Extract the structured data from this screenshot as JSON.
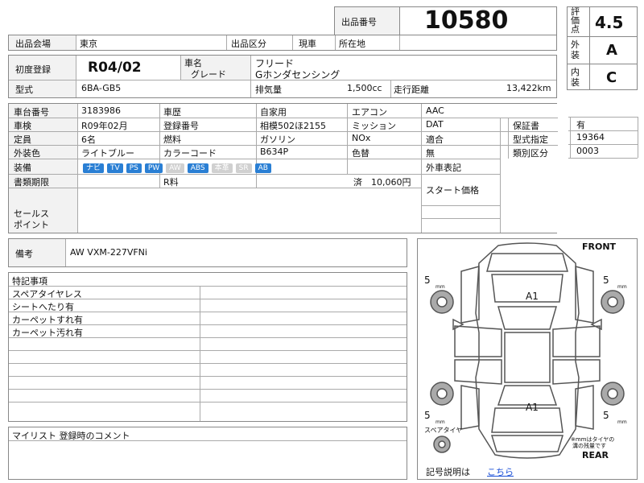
{
  "header": {
    "lot_number_label": "出品番号",
    "lot_number": "10580",
    "venue_label": "出品会場",
    "venue": "東京",
    "category_label": "出品区分",
    "category": "現車",
    "location_label": "所在地",
    "location": ""
  },
  "grades": {
    "overall_label": "評価点",
    "overall": "4.5",
    "exterior_label": "外装",
    "exterior": "A",
    "interior_label": "内装",
    "interior": "C"
  },
  "vehicle": {
    "first_reg_label": "初度登録",
    "first_reg": "R04/02",
    "name_label": "車名",
    "grade_label": "グレード",
    "name": "フリード",
    "grade": "Gホンダセンシング",
    "model_label": "型式",
    "model": "6BA-GB5",
    "displacement_label": "排気量",
    "displacement": "1,500cc",
    "mileage_label": "走行距離",
    "mileage": "13,422km"
  },
  "specs": {
    "chassis_label": "車台番号",
    "chassis": "3183986",
    "history_label": "車歴",
    "history": "自家用",
    "ac_label": "エアコン",
    "ac": "AAC",
    "inspection_label": "車検",
    "inspection": "R09年02月",
    "plate_label": "登録番号",
    "plate": "相模502ほ2155",
    "transmission_label": "ミッション",
    "transmission": "DAT",
    "warranty_label": "保証書",
    "warranty": "有",
    "capacity_label": "定員",
    "capacity": "6名",
    "fuel_label": "燃料",
    "fuel": "ガソリン",
    "nox_label": "NOx",
    "nox": "適合",
    "type_designation_label": "型式指定",
    "type_designation": "19364",
    "color_label": "外装色",
    "color": "ライトブルー",
    "color_code_label": "カラーコード",
    "color_code": "B634P",
    "recolor_label": "色替",
    "recolor": "無",
    "class_label": "類別区分",
    "class_code": "0003",
    "equipment_label": "装備",
    "equipment": [
      {
        "label": "ナビ",
        "on": true
      },
      {
        "label": "TV",
        "on": true
      },
      {
        "label": "PS",
        "on": true
      },
      {
        "label": "PW",
        "on": true
      },
      {
        "label": "AW",
        "on": false
      },
      {
        "label": "ABS",
        "on": true
      },
      {
        "label": "本革",
        "on": false
      },
      {
        "label": "SR",
        "on": false
      },
      {
        "label": "AB",
        "on": true
      }
    ],
    "foreign_label": "外車表記",
    "docs_label": "書類期限",
    "recycle_label": "R料",
    "recycle_status": "済",
    "recycle_amount": "10,060円",
    "start_price_label": "スタート価格",
    "sales_point_label": "セールス\nポイント"
  },
  "remarks": {
    "label": "備考",
    "value": "AW VXM-227VFNi"
  },
  "special_notes": {
    "title": "特記事項",
    "items": [
      "スペアタイヤレス",
      "シートへたり有",
      "カーペットすれ有",
      "カーペット汚れ有"
    ]
  },
  "comment": {
    "title": "マイリスト 登録時のコメント"
  },
  "diagram": {
    "front": "FRONT",
    "rear": "REAR",
    "mark_front": "A1",
    "mark_rear": "A1",
    "tire_depth": "5",
    "tire_unit": "mm",
    "spare_label": "スペアタイヤ",
    "note_line1": "※mmはタイヤの",
    "note_line2": "溝の残量です",
    "legend_label": "記号説明は",
    "legend_link": "こちら"
  }
}
